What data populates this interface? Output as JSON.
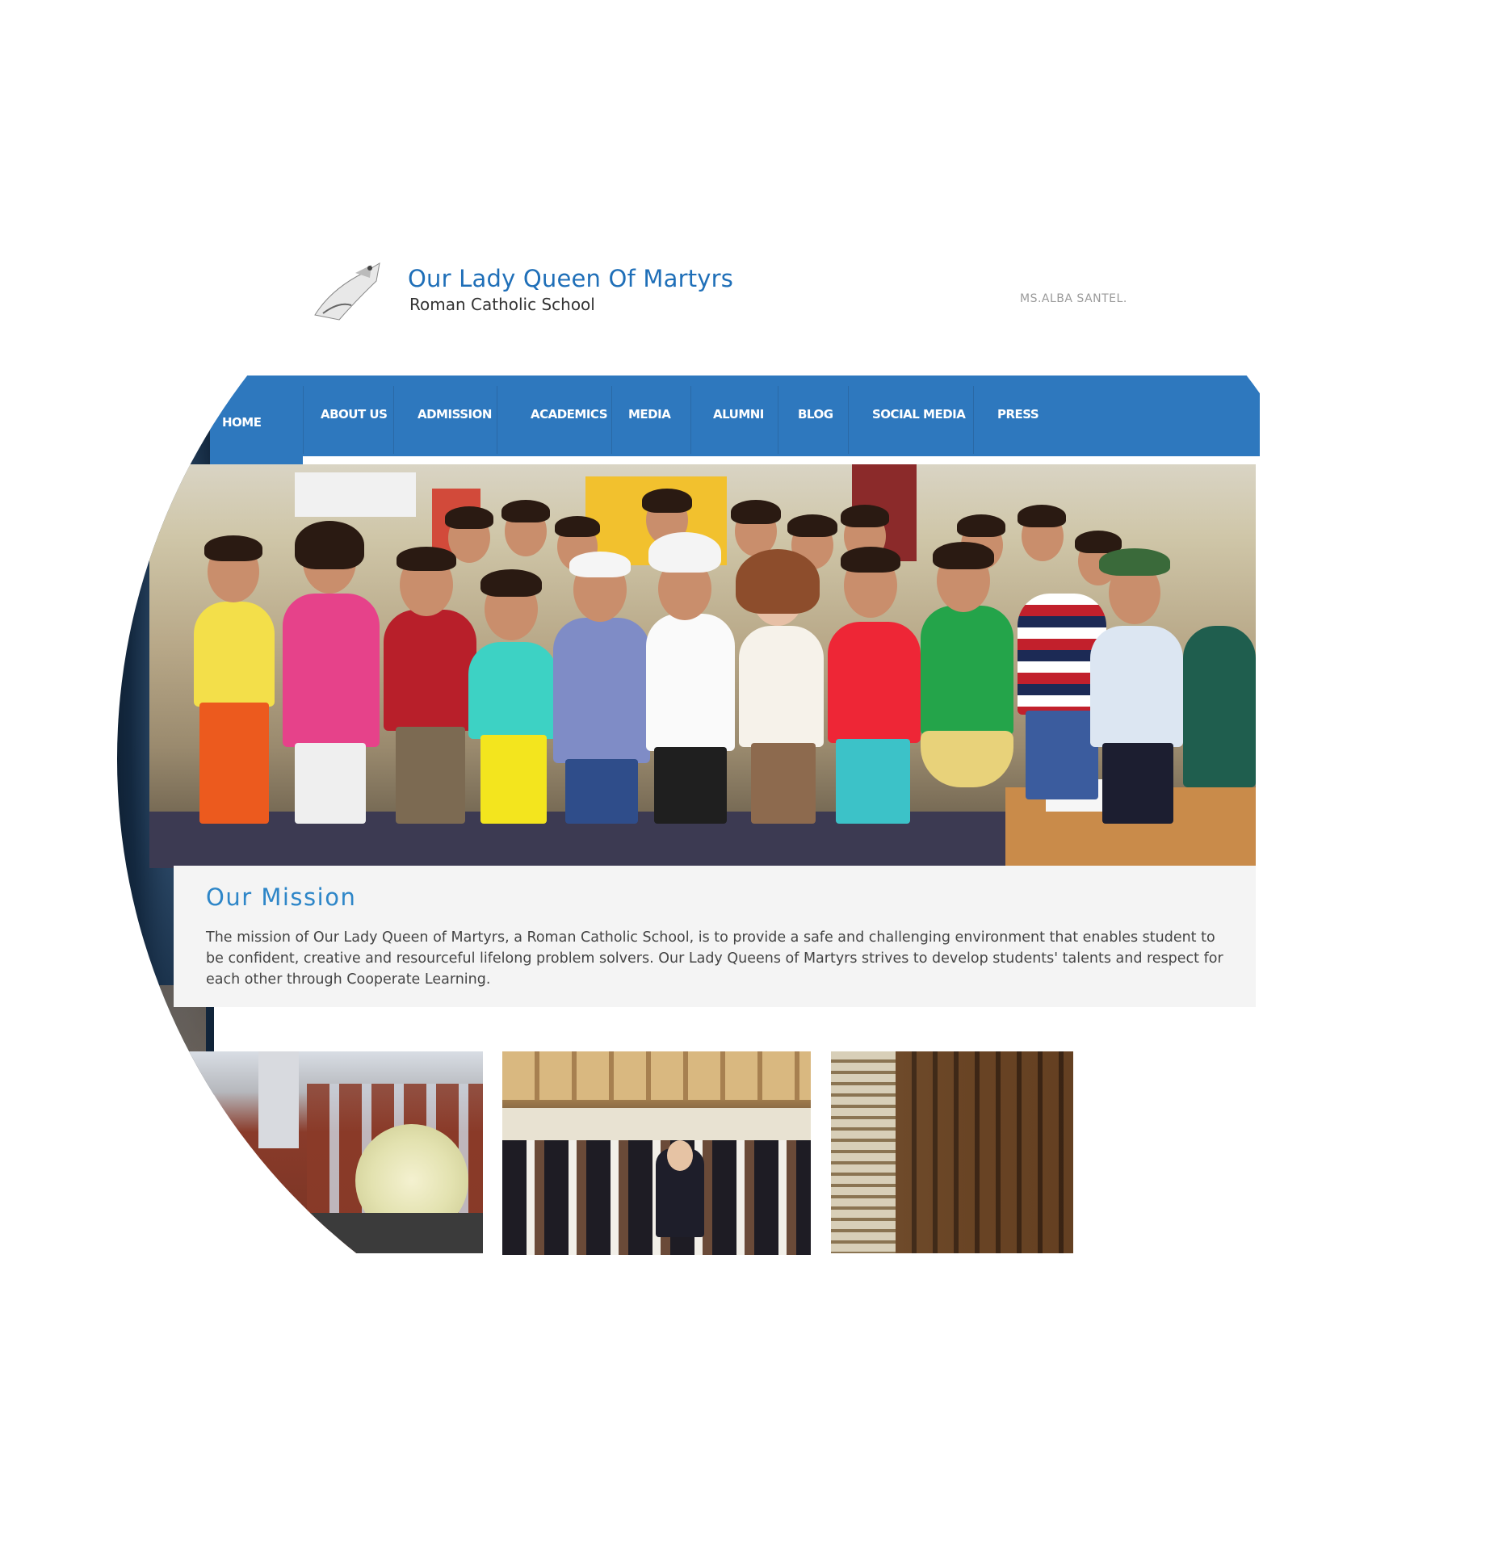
{
  "header": {
    "title": "Our Lady Queen Of Martyrs",
    "subtitle": "Roman Catholic School",
    "user_name": "MS.ALBA SANTEL."
  },
  "nav": {
    "items": [
      {
        "label": "HOME"
      },
      {
        "label": "ABOUT US"
      },
      {
        "label": "ADMISSION"
      },
      {
        "label": "ACADEMICS"
      },
      {
        "label": "MEDIA"
      },
      {
        "label": "ALUMNI"
      },
      {
        "label": "BLOG"
      },
      {
        "label": "SOCIAL MEDIA"
      },
      {
        "label": "PRESS"
      }
    ],
    "active": "HOME"
  },
  "mission": {
    "title": "Our Mission",
    "text": "The mission of Our Lady Queen of Martyrs, a Roman Catholic School, is to provide a safe and challenging environment that enables student to be confident, creative and resourceful lifelong problem solvers. Our Lady Queens of Martyrs strives to develop students' talents and respect for each other through Cooperate Learning."
  },
  "colors": {
    "nav_bg": "#2e78be",
    "title_blue": "#1f6fb8",
    "mission_title": "#2e86c8"
  }
}
